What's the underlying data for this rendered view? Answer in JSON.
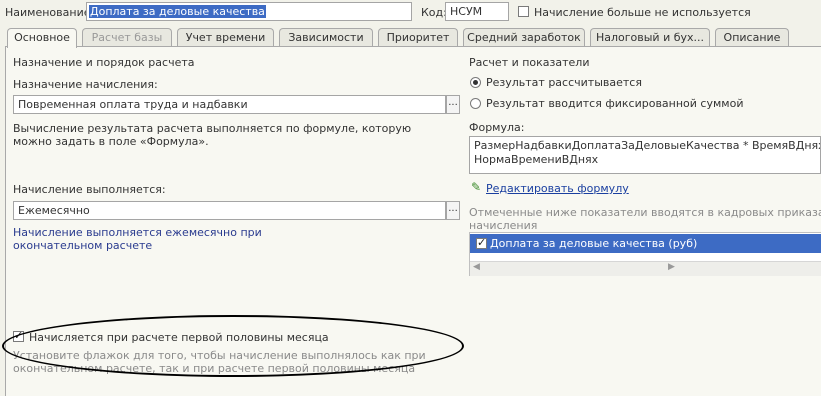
{
  "header": {
    "name_label": "Наименование:",
    "name_value": "Доплата за деловые качества",
    "code_label": "Код:",
    "code_value": "НСУМ",
    "unused_label": "Начисление больше не используется"
  },
  "tabs": [
    {
      "label": "Основное",
      "state": "active"
    },
    {
      "label": "Расчет базы",
      "state": "disabled"
    },
    {
      "label": "Учет времени",
      "state": "normal"
    },
    {
      "label": "Зависимости",
      "state": "normal"
    },
    {
      "label": "Приоритет",
      "state": "normal"
    },
    {
      "label": "Средний заработок",
      "state": "normal"
    },
    {
      "label": "Налоговый и бух...",
      "state": "normal"
    },
    {
      "label": "Описание",
      "state": "normal"
    }
  ],
  "left": {
    "section_title": "Назначение и порядок расчета",
    "purpose_label": "Назначение начисления:",
    "purpose_value": "Повременная оплата труда и надбавки",
    "purpose_hint": "Вычисление результата расчета выполняется по формуле, которую можно задать в поле «Формула».",
    "period_label": "Начисление выполняется:",
    "period_value": "Ежемесячно",
    "period_hint": "Начисление выполняется ежемесячно при окончательном расчете",
    "first_half_label": "Начисляется при расчете первой половины месяца",
    "first_half_hint": "Установите флажок для того, чтобы начисление выполнялось как при окончательном расчете, так и при расчете первой половины месяца",
    "ellipsis": "..."
  },
  "right": {
    "section_title": "Расчет и показатели",
    "radio_calculated": "Результат рассчитывается",
    "radio_fixed": "Результат вводится фиксированной суммой",
    "formula_label": "Формула:",
    "formula_line1": "РазмерНадбавкиДоплатаЗаДеловыеКачества * ВремяВДнях /",
    "formula_line2": "НормаВремениВДнях",
    "edit_formula_link": "Редактировать формулу",
    "indicators_hint_1": "Отмеченные ниже показатели вводятся в кадровых приказах пр",
    "indicators_hint_2": "начисления",
    "indicators": [
      {
        "label": "Доплата за деловые качества (руб)",
        "checked": true
      }
    ]
  },
  "colors": {
    "accent_selection": "#3d6bc4",
    "hint_blue": "#2a3b8f",
    "hint_gray": "#8a8a8a"
  }
}
